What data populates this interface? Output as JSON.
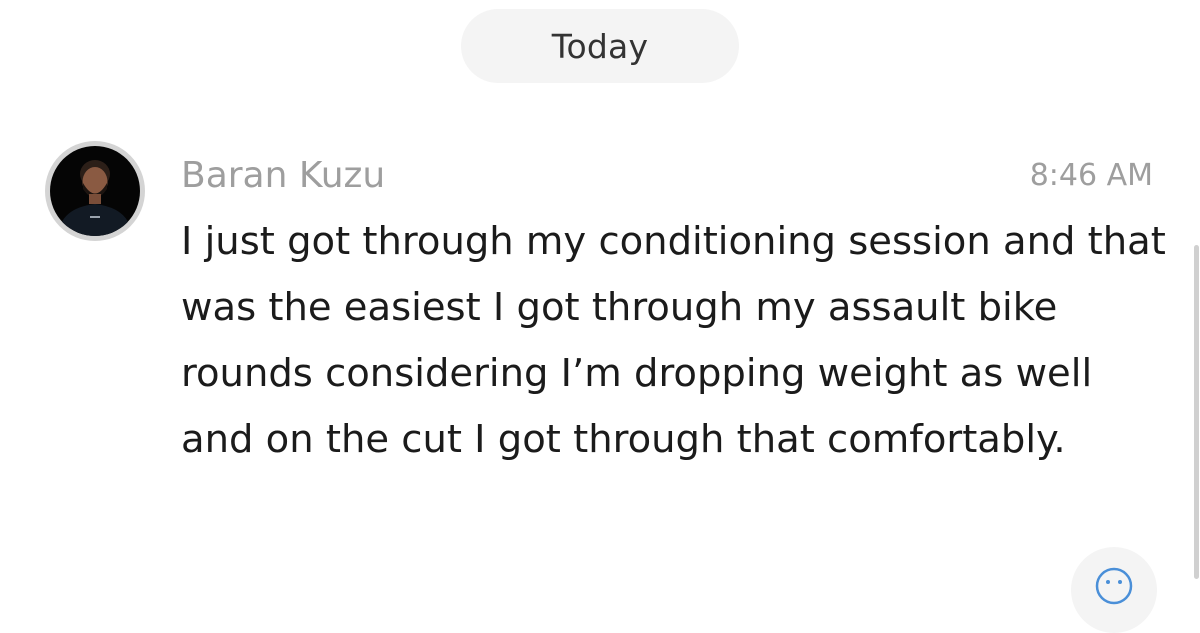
{
  "divider": {
    "date_label": "Today"
  },
  "message": {
    "sender": "Baran Kuzu",
    "time": "8:46 AM",
    "text": "I just got through my conditioning session and that was the easiest I got through my assault bike rounds considering I’m dropping weight as well and on the cut I got through that comfortably.",
    "avatar_icon": "profile-photo"
  },
  "controls": {
    "reaction_icon": "emoji-reaction-icon"
  }
}
